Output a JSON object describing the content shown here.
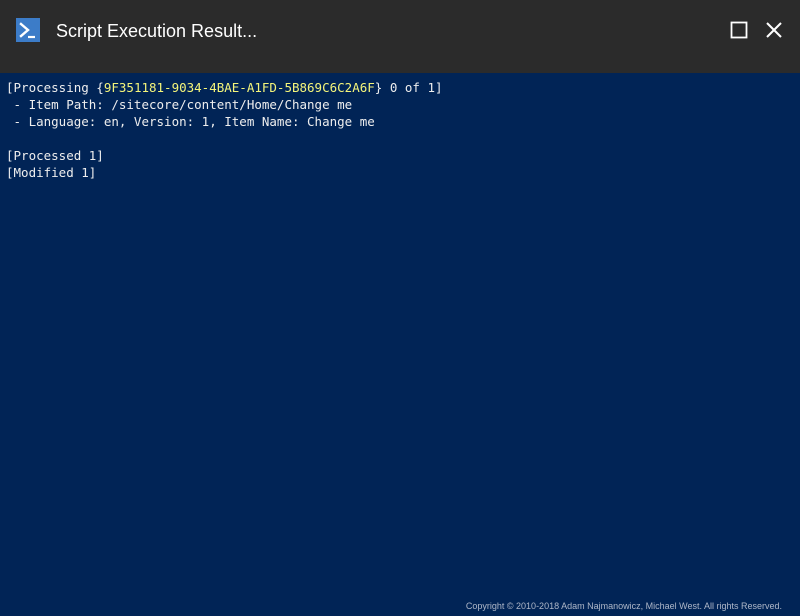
{
  "window": {
    "title": "Script Execution Result...",
    "icon": "powershell-icon",
    "controls": [
      "maximize-icon",
      "close-icon"
    ]
  },
  "console": {
    "line1_prefix": "[Processing {",
    "line1_guid": "9F351181-9034-4BAE-A1FD-5B869C6C2A6F",
    "line1_suffix": "} 0 of 1]",
    "line2": " - Item Path: /sitecore/content/Home/Change me",
    "line3": " - Language: en, Version: 1, Item Name: Change me",
    "line4": "",
    "line5": "[Processed 1]",
    "line6": "[Modified 1]"
  },
  "footer": {
    "copyright": "Copyright © 2010-2018 Adam Najmanowicz, Michael West. All rights Reserved."
  },
  "colors": {
    "console_bg": "#012456",
    "titlebar_bg": "#2b2b2b",
    "console_text": "#eeeeee",
    "guid_highlight": "#f5f57a",
    "icon_blue": "#3c7cc8"
  }
}
